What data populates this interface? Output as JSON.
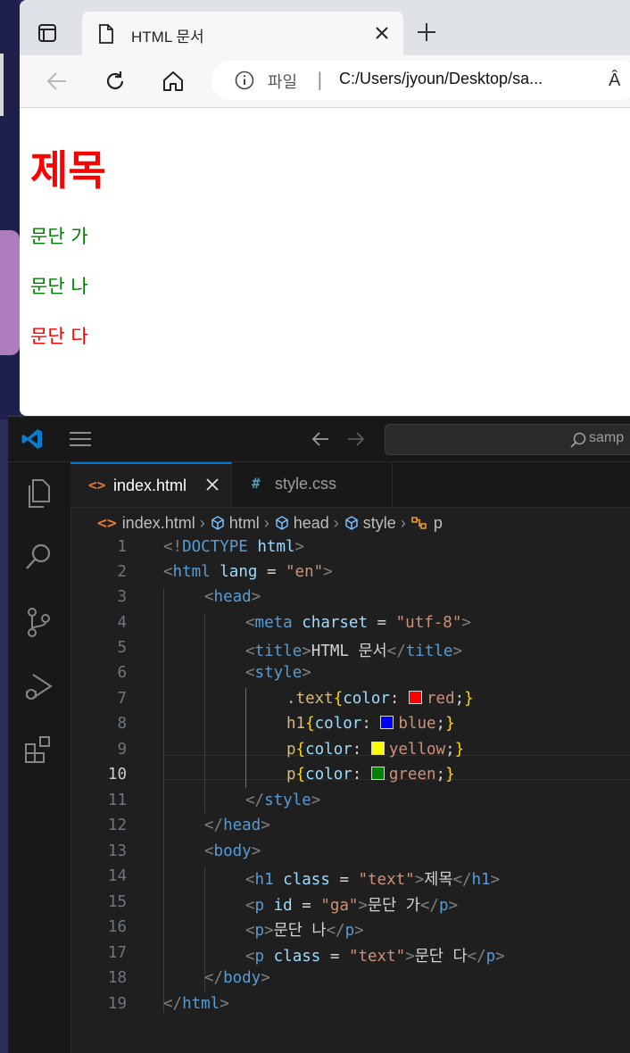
{
  "browser": {
    "tab_title": "HTML 문서",
    "address": {
      "scheme": "파일",
      "separator": "|",
      "url": "C:/Users/jyoun/Desktop/sa..."
    },
    "read_aloud": "Â",
    "page": {
      "heading": "제목",
      "paragraphs": [
        {
          "text": "문단 가",
          "color": "#008000"
        },
        {
          "text": "문단 나",
          "color": "#008000"
        },
        {
          "text": "문단 다",
          "color": "#ff0000"
        }
      ]
    }
  },
  "vscode": {
    "search_text": "samp",
    "tabs": [
      {
        "label": "index.html",
        "icon": "<>",
        "active": true
      },
      {
        "label": "style.css",
        "icon": "#",
        "active": false
      }
    ],
    "breadcrumb": [
      "index.html",
      "html",
      "head",
      "style",
      "p"
    ],
    "current_line": 10,
    "lines": [
      {
        "n": "1"
      },
      {
        "n": "2"
      },
      {
        "n": "3"
      },
      {
        "n": "4"
      },
      {
        "n": "5"
      },
      {
        "n": "6"
      },
      {
        "n": "7"
      },
      {
        "n": "8"
      },
      {
        "n": "9"
      },
      {
        "n": "10"
      },
      {
        "n": "11"
      },
      {
        "n": "12"
      },
      {
        "n": "13"
      },
      {
        "n": "14"
      },
      {
        "n": "15"
      },
      {
        "n": "16"
      },
      {
        "n": "17"
      },
      {
        "n": "18"
      },
      {
        "n": "19"
      }
    ],
    "code": {
      "l1": {
        "a": "<!",
        "b": "DOCTYPE",
        "c": " ",
        "d": "html",
        "e": ">"
      },
      "l2": {
        "tag": "html",
        "att": "lang",
        "eq": " = ",
        "val": "\"en\""
      },
      "l3": {
        "tag": "head"
      },
      "l4": {
        "tag": "meta",
        "att": "charset",
        "eq": " = ",
        "val": "\"utf-8\""
      },
      "l5": {
        "tag": "title",
        "text": "HTML 문서"
      },
      "l6": {
        "tag": "style"
      },
      "l7": {
        "sel": ".text",
        "prop": "color",
        "val": "red",
        "swatch": "#ff0000"
      },
      "l8": {
        "sel": "h1",
        "prop": "color",
        "val": "blue",
        "swatch": "#0000ff"
      },
      "l9": {
        "sel": "p",
        "prop": "color",
        "val": "yellow",
        "swatch": "#ffff00"
      },
      "l10": {
        "sel": "p",
        "prop": "color",
        "val": "green",
        "swatch": "#008000"
      },
      "l11": {
        "tag": "style"
      },
      "l12": {
        "tag": "head"
      },
      "l13": {
        "tag": "body"
      },
      "l14": {
        "tag": "h1",
        "att": "class",
        "eq": " = ",
        "val": "\"text\"",
        "text": "제목"
      },
      "l15": {
        "tag": "p",
        "att": "id",
        "eq": " = ",
        "val": "\"ga\"",
        "text": "문단 가"
      },
      "l16": {
        "tag": "p",
        "text": "문단 나"
      },
      "l17": {
        "tag": "p",
        "att": "class",
        "eq": " = ",
        "val": "\"text\"",
        "text": "문단 다"
      },
      "l18": {
        "tag": "body"
      },
      "l19": {
        "tag": "html"
      }
    }
  }
}
